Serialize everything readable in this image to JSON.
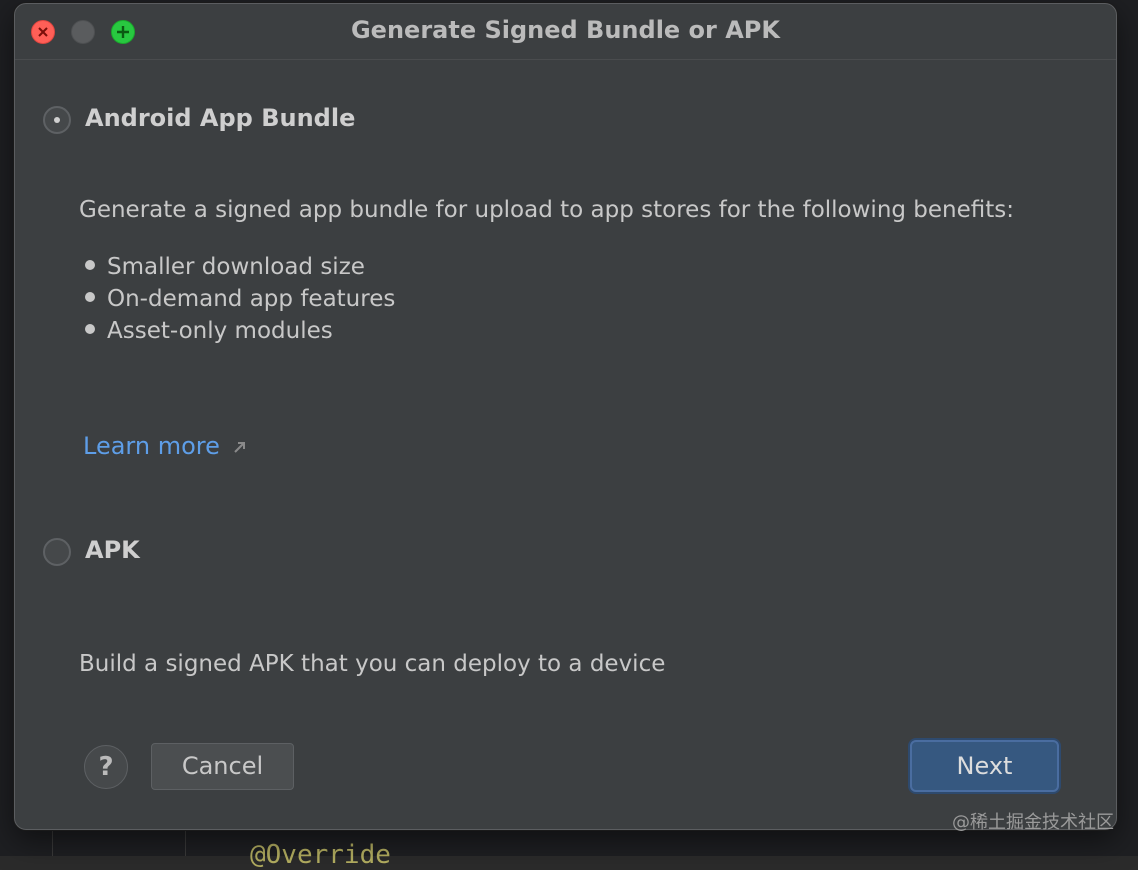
{
  "window": {
    "title": "Generate Signed Bundle or APK"
  },
  "options": {
    "bundle": {
      "label": "Android App Bundle",
      "selected": true,
      "description": "Generate a signed app bundle for upload to app stores for the following benefits:",
      "benefits": [
        "Smaller download size",
        "On-demand app features",
        "Asset-only modules"
      ],
      "learn_more": "Learn more"
    },
    "apk": {
      "label": "APK",
      "selected": false,
      "description": "Build a signed APK that you can deploy to a device"
    }
  },
  "footer": {
    "help_label": "?",
    "cancel_label": "Cancel",
    "next_label": "Next"
  },
  "background": {
    "code_fragment": "@Override"
  },
  "watermark": "@稀土掘金技术社区",
  "colors": {
    "link": "#5e9ee8",
    "primary_button": "#365880",
    "dialog_bg": "#3c3f41"
  }
}
